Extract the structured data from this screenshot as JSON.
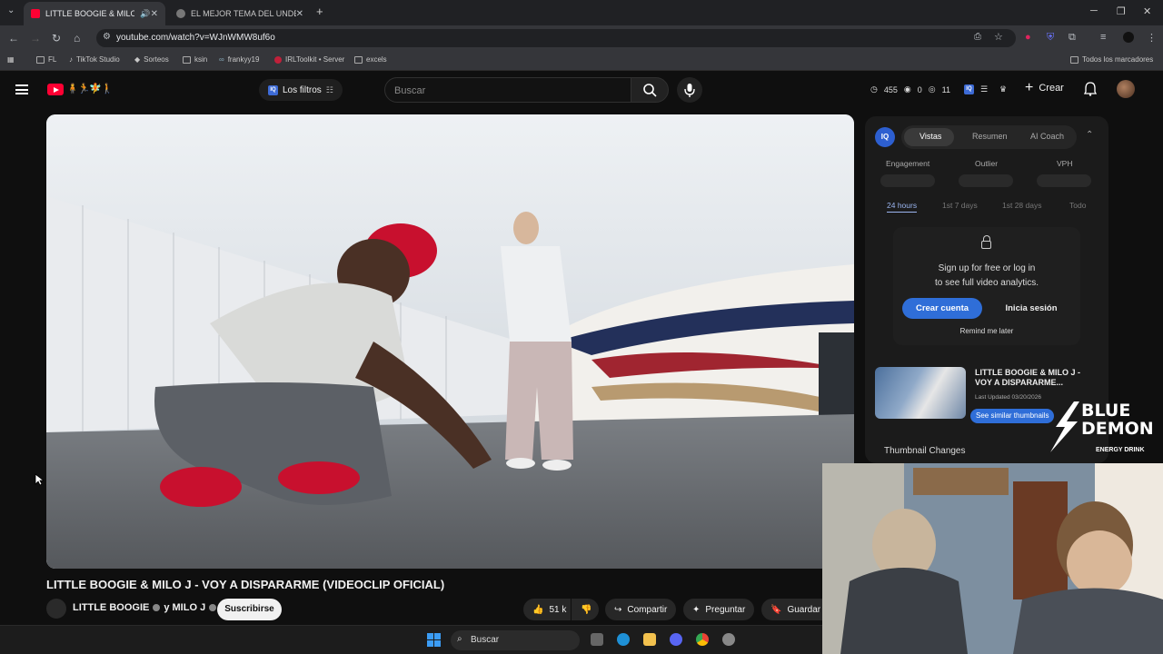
{
  "browser": {
    "tabs": [
      {
        "title": "LITTLE BOOGIE & MILO J -",
        "active": true
      },
      {
        "title": "EL MEJOR TEMA DEL UNDER B",
        "active": false
      }
    ],
    "new_tab": "+",
    "url": "youtube.com/watch?v=WJnWMW8uf6o",
    "bookmarks": [
      "FL",
      "TikTok Studio",
      "Sorteos",
      "ksin",
      "frankyy19",
      "IRLToolkit • Server",
      "excels"
    ],
    "all_bookmarks": "Todos los marcadores"
  },
  "masthead": {
    "filters_label": "Los filtros",
    "search_placeholder": "Buscar",
    "stats": {
      "watch": "455",
      "views": "0",
      "eye": "11"
    },
    "create_label": "Crear"
  },
  "video": {
    "title": "LITTLE BOOGIE & MILO J - VOY A DISPARARME (VIDEOCLIP OFICIAL)",
    "channel": "LITTLE BOOGIE",
    "channel_joiner": "y MILO J",
    "subscribe_label": "Suscribirse",
    "likes": "51 k",
    "share_label": "Compartir",
    "ask_label": "Preguntar",
    "save_label": "Guardar"
  },
  "panel": {
    "logo": "IQ",
    "tabs": [
      "Vistas",
      "Resumen",
      "AI Coach"
    ],
    "metrics": [
      "Engagement",
      "Outlier",
      "VPH"
    ],
    "ranges": [
      "24 hours",
      "1st 7 days",
      "1st 28 days",
      "Todo"
    ],
    "lock_msg_1": "Sign up for free or log in",
    "lock_msg_2": "to see full video analytics.",
    "create_account": "Crear cuenta",
    "login": "Inicia sesión",
    "remind": "Remind me later",
    "thumb_title": "LITTLE BOOGIE & MILO J - VOY A DISPARARME...",
    "thumb_date": "Last Updated 03/20/2026",
    "similar_btn": "See similar thumbnails",
    "thumbnail_changes": "Thumbnail Changes"
  },
  "overlay": {
    "brand_line1": "BLUE",
    "brand_line2": "DEMON",
    "brand_line3": "ENERGY DRINK"
  },
  "taskbar": {
    "search_label": "Buscar"
  },
  "colors": {
    "bg": "#0f0f0f",
    "accent_blue": "#2f6ed8",
    "yt_red": "#ff0033"
  }
}
